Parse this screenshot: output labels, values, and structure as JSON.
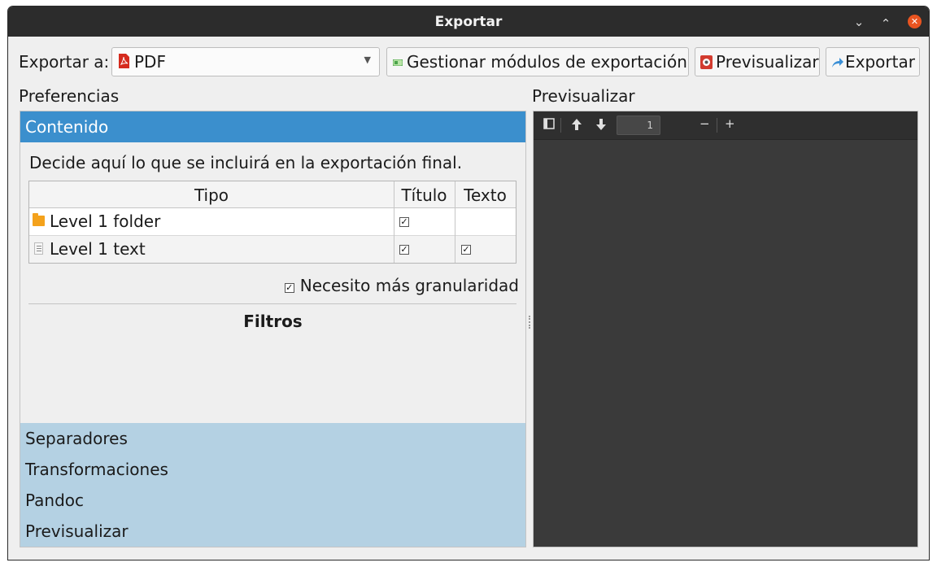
{
  "window": {
    "title": "Exportar"
  },
  "toolbar": {
    "export_to_label": "Exportar a:",
    "format_selected": "PDF",
    "manage_modules_label": "Gestionar módulos de exportación",
    "preview_label": "Previsualizar",
    "export_label": "Exportar"
  },
  "preferences": {
    "title": "Preferencias",
    "sections": {
      "content": "Contenido",
      "separators": "Separadores",
      "transformations": "Transformaciones",
      "pandoc": "Pandoc",
      "preview": "Previsualizar"
    },
    "content": {
      "description": "Decide aquí lo que se incluirá en la exportación final.",
      "table": {
        "headers": [
          "Tipo",
          "Título",
          "Texto"
        ],
        "rows": [
          {
            "type": "Level 1 folder",
            "icon": "folder-icon",
            "title_checked": true,
            "text_checked": null
          },
          {
            "type": "Level 1 text",
            "icon": "text-file-icon",
            "title_checked": true,
            "text_checked": true
          }
        ]
      },
      "granularity_label": "Necesito más granularidad",
      "granularity_checked": true,
      "filters_title": "Filtros"
    }
  },
  "preview": {
    "title": "Previsualizar",
    "page_number": "1"
  },
  "colors": {
    "titlebar": "#2c2c2c",
    "accent_active": "#3b8fcd",
    "accent_inactive": "#b4d1e3",
    "close_button": "#e95420",
    "preview_bg": "#3a3a3a"
  }
}
